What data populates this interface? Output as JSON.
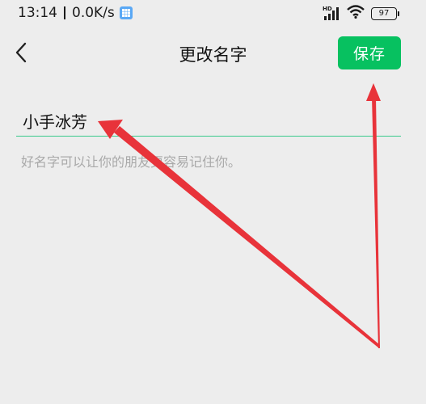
{
  "status_bar": {
    "time": "13:14",
    "network_speed": "0.0K/s",
    "signal_badge": "HD",
    "battery_level": "97",
    "icons": [
      "app-notification-icon",
      "signal-icon",
      "wifi-icon",
      "battery-icon"
    ]
  },
  "header": {
    "back_icon": "chevron-left-icon",
    "title": "更改名字",
    "save_label": "保存"
  },
  "form": {
    "name_value": "小手冰芳",
    "hint": "好名字可以让你的朋友更容易记住你。"
  },
  "colors": {
    "accent": "#07c160",
    "underline": "#39c98b",
    "background": "#ededed",
    "annotation_arrow": "#e8333a"
  }
}
